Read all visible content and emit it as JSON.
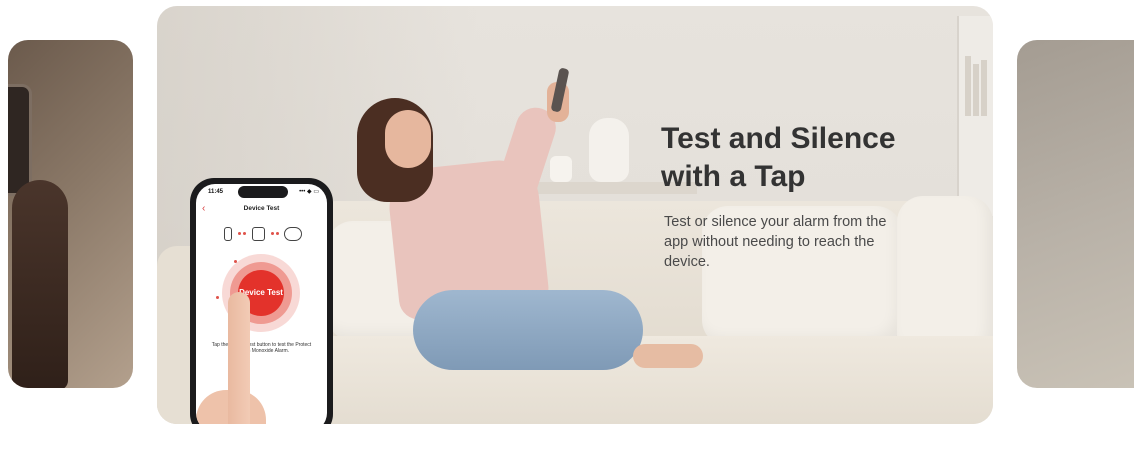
{
  "feature": {
    "headline": "Test and Silence with a Tap",
    "description": "Test or silence your alarm from the app without needing to reach the device."
  },
  "phone_app": {
    "status_time": "11:45",
    "status_icons": "••• ◆ ▭",
    "back_icon": "‹",
    "screen_title": "Device Test",
    "button_label": "Device Test",
    "caption": "Tap the Device Test button to test the Protect Carbon Monoxide Alarm."
  },
  "colors": {
    "accent_red": "#e3322b",
    "headline_text": "#333333",
    "body_text": "#4a4a4a"
  }
}
